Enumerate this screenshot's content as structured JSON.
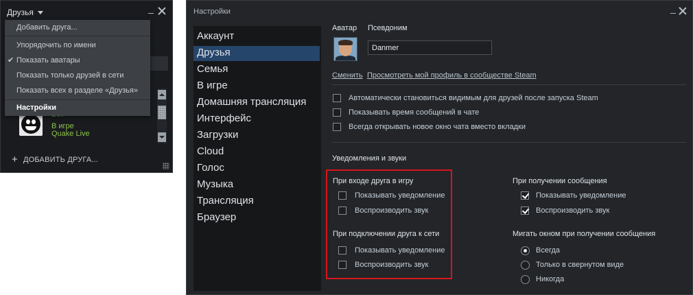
{
  "friends_window": {
    "title": "Друзья",
    "add_friend": "ДОБАВИТЬ ДРУГА...",
    "friend": {
      "name": "Bot",
      "status": "В игре",
      "game": "Quake Live"
    },
    "menu": {
      "items": [
        "Добавить друга...",
        "Упорядочить по имени",
        "Показать аватары",
        "Показать только друзей в сети",
        "Показать всех в разделе «Друзья»",
        "Настройки"
      ],
      "checked_item": "Показать аватары",
      "bold_item": "Настройки"
    }
  },
  "settings_window": {
    "title": "Настройки",
    "nav": [
      "Аккаунт",
      "Друзья",
      "Семья",
      "В игре",
      "Домашняя трансляция",
      "Интерфейс",
      "Загрузки",
      "Cloud",
      "Голос",
      "Музыка",
      "Трансляция",
      "Браузер"
    ],
    "active_nav": "Друзья",
    "avatar_label": "Аватар",
    "nickname_label": "Псевдоним",
    "nickname_value": "Danmer",
    "change_link": "Сменить",
    "profile_link": "Просмотреть мой профиль в сообществе Steam",
    "options": [
      {
        "label": "Автоматически становиться видимым для друзей после запуска Steam",
        "checked": false
      },
      {
        "label": "Показывать время сообщений в чате",
        "checked": false
      },
      {
        "label": "Всегда открывать новое окно чата вместо вкладки",
        "checked": false
      }
    ],
    "notifications_header": "Уведомления и звуки",
    "friend_joins_game": {
      "header": "При входе друга в игру",
      "show_notification": {
        "label": "Показывать уведомление",
        "checked": false
      },
      "play_sound": {
        "label": "Воспроизводить звук",
        "checked": false
      }
    },
    "friend_online": {
      "header": "При подключении друга к сети",
      "show_notification": {
        "label": "Показывать уведомление",
        "checked": false
      },
      "play_sound": {
        "label": "Воспроизводить звук",
        "checked": false
      }
    },
    "message_received": {
      "header": "При получении сообщения",
      "show_notification": {
        "label": "Показывать уведомление",
        "checked": true
      },
      "play_sound": {
        "label": "Воспроизводить звук",
        "checked": true
      }
    },
    "flash_window": {
      "header": "Мигать окном при получении сообщения",
      "options": [
        "Всегда",
        "Только в свернутом виде",
        "Никогда"
      ],
      "selected": "Всегда"
    }
  },
  "colors": {
    "highlight_box": "#d8151d",
    "active_nav": "#26456a",
    "friend_ingame": "#8bc34a"
  }
}
